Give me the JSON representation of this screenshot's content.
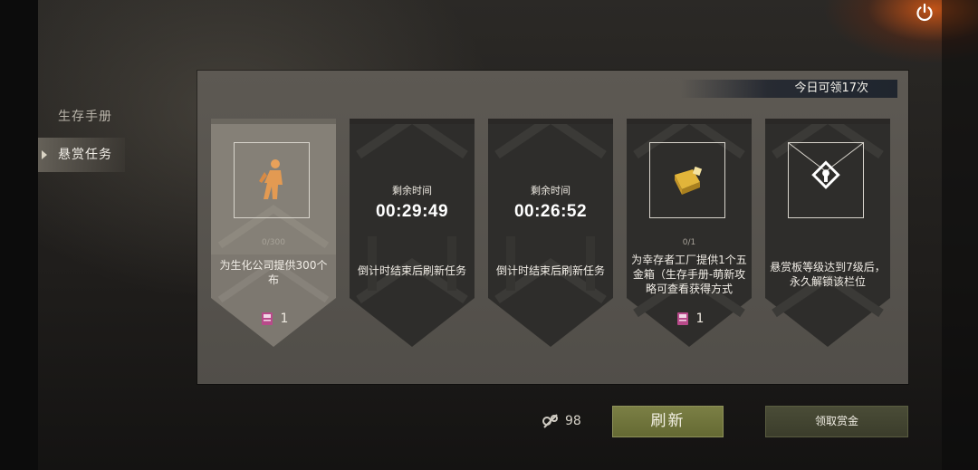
{
  "side_menu": {
    "items": [
      {
        "label": "生存手册",
        "active": false
      },
      {
        "label": "悬赏任务",
        "active": true
      }
    ]
  },
  "board": {
    "quota_text": "今日可领17次",
    "cards": [
      {
        "state": "task",
        "icon": "survivor-figure-icon",
        "progress": "0/300",
        "description": "为生化公司提供300个布",
        "reward_icon": "book-icon",
        "reward_count": "1"
      },
      {
        "state": "cooldown",
        "timer_label": "剩余时间",
        "timer": "00:29:49",
        "description": "倒计时结束后刷新任务"
      },
      {
        "state": "cooldown",
        "timer_label": "剩余时间",
        "timer": "00:26:52",
        "description": "倒计时结束后刷新任务"
      },
      {
        "state": "task",
        "icon": "gold-box-icon",
        "progress": "0/1",
        "description": "为幸存者工厂提供1个五金箱（生存手册-萌新攻略可查看获得方式",
        "reward_icon": "book-icon",
        "reward_count": "1"
      },
      {
        "state": "locked",
        "icon": "lock-icon",
        "description": "悬赏板等级达到7级后，永久解锁该栏位"
      }
    ]
  },
  "footer": {
    "currency_icon": "parts-icon",
    "currency_amount": "98",
    "refresh_label": "刷新",
    "claim_label": "领取赏金"
  },
  "colors": {
    "board_bg": "#57544e",
    "refresh_btn": "#6f7339",
    "claim_btn": "#43452f",
    "accent_fire": "#d85a14"
  }
}
